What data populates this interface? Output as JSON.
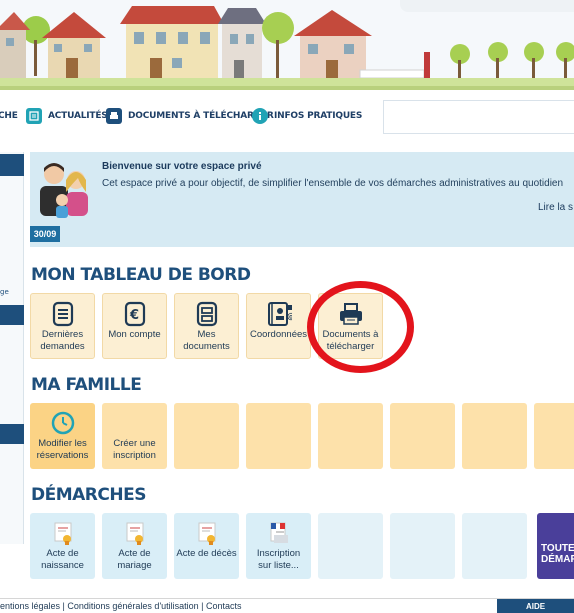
{
  "nav": {
    "items": [
      {
        "label": "CHE",
        "icon": "home-icon"
      },
      {
        "label": "ACTUALITÉS",
        "icon": "news-icon"
      },
      {
        "label": "DOCUMENTS À TÉLÉCHARGER",
        "icon": "printer-icon"
      },
      {
        "label": "INFOS PRATIQUES",
        "icon": "info-icon"
      }
    ]
  },
  "sidebar": {
    "fragment_label": "ge"
  },
  "welcome": {
    "title": "Bienvenue sur votre espace privé",
    "description": "Cet espace privé a pour objectif, de simplifier l'ensemble de vos démarches administratives au quotidien",
    "read_more": "Lire la s",
    "date": "30/09"
  },
  "dashboard": {
    "title": "MON TABLEAU DE BORD",
    "tiles": [
      {
        "line1": "Dernières",
        "line2": "demandes",
        "icon": "list-icon"
      },
      {
        "line1": "Mon compte",
        "line2": "",
        "icon": "euro-icon"
      },
      {
        "line1": "Mes",
        "line2": "documents",
        "icon": "documents-icon"
      },
      {
        "line1": "Coordonnées",
        "line2": "",
        "icon": "contact-book-icon"
      },
      {
        "line1": "Documents à",
        "line2": "télécharger",
        "icon": "printer-icon"
      }
    ]
  },
  "family": {
    "title": "MA FAMILLE",
    "tiles": [
      {
        "line1": "Modifier les",
        "line2": "réservations",
        "icon": "clock-icon"
      },
      {
        "line1": "Créer une",
        "line2": "inscription",
        "icon": ""
      }
    ]
  },
  "procedures": {
    "title": "DÉMARCHES",
    "tiles": [
      {
        "line1": "Acte de",
        "line2": "naissance",
        "icon": "certificate-icon"
      },
      {
        "line1": "Acte de",
        "line2": "mariage",
        "icon": "certificate-icon"
      },
      {
        "line1": "Acte de décès",
        "line2": "",
        "icon": "certificate-icon"
      },
      {
        "line1": "Inscription",
        "line2": "sur liste...",
        "icon": "ballot-icon"
      }
    ],
    "all_button_line1": "TOUTES",
    "all_button_line2": "DÉMARC"
  },
  "footer": {
    "links": "entions légales | Conditions générales d'utilisation | Contacts",
    "help": "AIDE"
  },
  "colors": {
    "accent_blue": "#1e4f7c",
    "teal": "#21a3b5",
    "tile_orange": "#fde1aa",
    "tile_blue": "#d9eef7",
    "annotation_red": "#e3141c",
    "purple": "#4a3f9a"
  }
}
